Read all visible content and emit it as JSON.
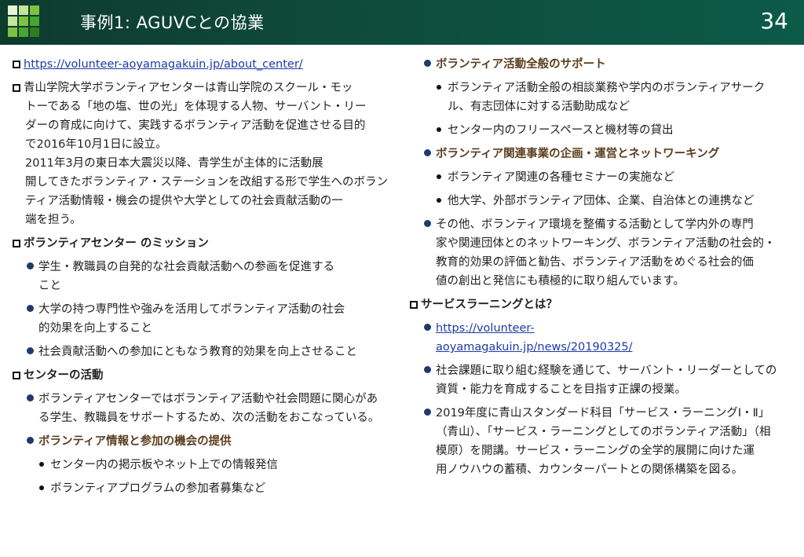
{
  "header": {
    "title": "事例1: AGUVCとの協業",
    "page_number": "34"
  },
  "left": {
    "url": "https://volunteer-aoyamagakuin.jp/about_center/",
    "intro": [
      "青山学院大学ボランティアセンターは青山学院のスクール・モッ",
      "トーである「地の塩、世の光」を体現する人物、サーバント・リー",
      "ダーの育成に向けて、実践するボランティア活動を促進させる目的",
      "で2016年10月1日に設立。",
      "2011年3月の東日本大震災以降、青学生が主体的に活動展",
      "開してきたボランティア・ステーションを改組する形で学生へのボラン",
      "ティア活動情報・機会の提供や大学としての社会貢献活動の一",
      "端を担う。"
    ],
    "mission_heading": "ボランティアセンター のミッション",
    "missions": [
      [
        "学生・教職員の自発的な社会貢献活動への参画を促進する",
        "こと"
      ],
      [
        "大学の持つ専門性や強みを活用してボランティア活動の社会",
        "的効果を向上すること"
      ],
      [
        "社会貢献活動への参加にともなう教育的効果を向上させること"
      ]
    ],
    "activity_heading": "センターの活動",
    "activity_intro": [
      "ボランティアセンターではボランティア活動や社会問題に関心があ",
      "る学生、教職員をサポートするため、次の活動をおこなっている。"
    ],
    "info_heading": "ボランティア情報と参加の機会の提供",
    "info_items": [
      "センター内の掲示板やネット上での情報発信",
      "ボランティアプログラムの参加者募集など"
    ]
  },
  "right": {
    "support_heading": "ボランティア活動全般のサポート",
    "support_items": [
      [
        "ボランティア活動全般の相談業務や学内のボランティアサーク",
        "ル、有志団体に対する活動助成など"
      ],
      [
        "センター内のフリースペースと機材等の貸出"
      ]
    ],
    "planning_heading": "ボランティア関連事業の企画・運営とネットワーキング",
    "planning_items": [
      "ボランティア関連の各種セミナーの実施など",
      "他大学、外部ボランティア団体、企業、自治体との連携など"
    ],
    "other": [
      "その他、ボランティア環境を整備する活動として学内外の専門",
      "家や関連団体とのネットワーキング、ボランティア活動の社会的・",
      "教育的効果の評価と勧告、ボランティア活動をめぐる社会的価",
      "値の創出と発信にも積極的に取り組んでいます。"
    ],
    "sl_heading": "サービスラーニングとは？",
    "sl_url": [
      "https://volunteer-",
      "aoyamagakuin.jp/news/20190325/"
    ],
    "sl_desc": [
      "社会課題に取り組む経験を通じて、サーバント・リーダーとしての",
      "資質・能力を育成することを目指す正課の授業。"
    ],
    "sl_2019": [
      "2019年度に青山スタンダード科目「サービス・ラーニングⅠ・Ⅱ」",
      "（青山）、「サービス・ラーニングとしてのボランティア活動」（相",
      "模原）を開講。サービス・ラーニングの全学的展開に向けた運",
      "用ノウハウの蓄積、カウンターパートとの関係構築を図る。"
    ]
  },
  "colors": {
    "header_bg": "#0f4a3a",
    "bullet": "#1e3a6e",
    "heading_brown": "#5b3e1e",
    "link": "#1e3aa6"
  }
}
